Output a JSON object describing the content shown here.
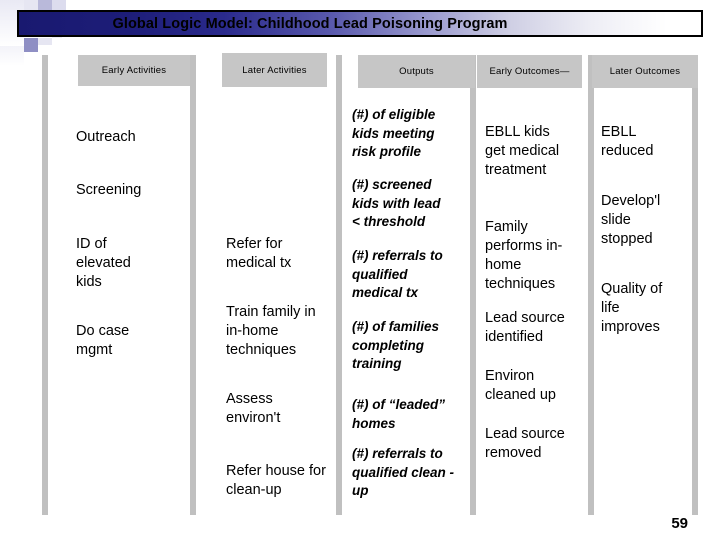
{
  "slide": {
    "title": "Global Logic Model: Childhood Lead Poisoning Program",
    "page_number": "59",
    "accent_color": "#191970",
    "header_box_color": "#c6c6c6",
    "divider_color": "#c0c0c0"
  },
  "columns": [
    {
      "header": "Early Activities",
      "style": "plain",
      "items": [
        "Outreach",
        "Screening",
        "ID of elevated kids",
        "Do  case mgmt"
      ]
    },
    {
      "header": "Later Activities",
      "style": "plain",
      "items": [
        "Refer for medical tx",
        "Train family in in-home techniques",
        "Assess environ't",
        "Refer house for clean-up"
      ]
    },
    {
      "header": "Outputs",
      "style": "bold-italic",
      "items": [
        "(#) of eligible kids meeting risk profile",
        "(#) screened kids with lead < threshold",
        "(#) referrals to qualified medical tx",
        "(#) of families completing training",
        "(#) of “leaded” homes",
        "(#) referrals to qualified clean -up"
      ]
    },
    {
      "header": "Early Outcomes—",
      "style": "plain",
      "items": [
        "EBLL kids get medical treatment",
        "Family performs in-home techniques",
        "Lead source identified",
        "Environ cleaned up",
        "Lead source removed"
      ]
    },
    {
      "header": "Later Outcomes",
      "style": "plain",
      "items": [
        "EBLL reduced",
        "Develop'l slide stopped",
        "Quality of life improves"
      ]
    }
  ]
}
